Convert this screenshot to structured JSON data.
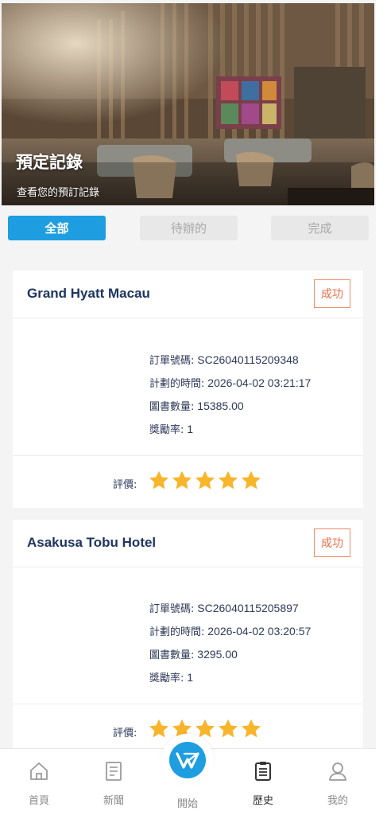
{
  "header": {
    "title": "預定記錄",
    "subtitle": "查看您的預訂記錄"
  },
  "tabs": [
    {
      "label": "全部"
    },
    {
      "label": "待辦的"
    },
    {
      "label": "完成"
    }
  ],
  "labels": {
    "order_no": "訂單號碼:",
    "planned_time": "計劃的時間:",
    "book_count": "圖書數量:",
    "reward_rate": "獎勵率:",
    "rating": "評價:"
  },
  "orders": [
    {
      "hotel": "Grand Hyatt Macau",
      "status": "成功",
      "order_no": "SC26040115209348",
      "planned_time": "2026-04-02 03:21:17",
      "book_count": "15385.00",
      "reward_rate": "1",
      "rating": 5
    },
    {
      "hotel": "Asakusa Tobu Hotel",
      "status": "成功",
      "order_no": "SC26040115205897",
      "planned_time": "2026-04-02 03:20:57",
      "book_count": "3295.00",
      "reward_rate": "1",
      "rating": 5
    }
  ],
  "nav": [
    {
      "label": "首頁",
      "icon": "home-icon"
    },
    {
      "label": "新聞",
      "icon": "news-icon"
    },
    {
      "label": "開始",
      "icon": "start-logo-icon"
    },
    {
      "label": "歷史",
      "icon": "history-icon"
    },
    {
      "label": "我的",
      "icon": "profile-icon"
    }
  ],
  "colors": {
    "accent": "#1e9ee0",
    "status": "#ef6f4a",
    "star": "#f7b52c",
    "hotel_name": "#1e3560"
  }
}
